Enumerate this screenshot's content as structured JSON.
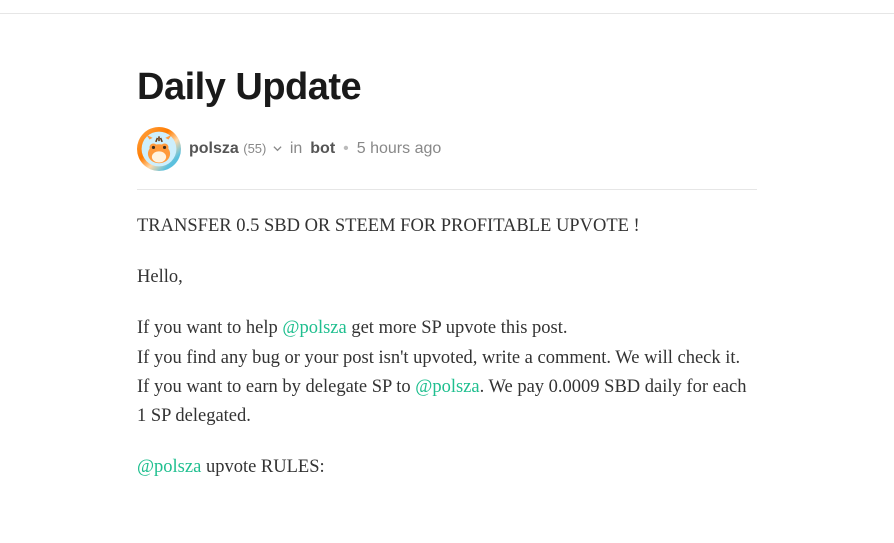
{
  "post": {
    "title": "Daily Update",
    "author": "polsza",
    "reputation": "(55)",
    "category_prefix": "in",
    "category": "bot",
    "separator": "•",
    "timestamp": "5 hours ago"
  },
  "body": {
    "headline": "TRANSFER 0.5 SBD OR STEEM FOR PROFITABLE UPVOTE !",
    "greeting": "Hello,",
    "p1_a": "If you want to help ",
    "p1_mention": "@polsza",
    "p1_b": " get more SP upvote this post.",
    "p2": "If you find any bug or your post isn't upvoted, write a comment. We will check it.",
    "p3_a": "If you want to earn by delegate SP to ",
    "p3_mention": "@polsza",
    "p3_b": ". We pay 0.0009 SBD daily for each 1 SP delegated.",
    "p4_mention": "@polsza",
    "p4_b": " upvote RULES:"
  }
}
